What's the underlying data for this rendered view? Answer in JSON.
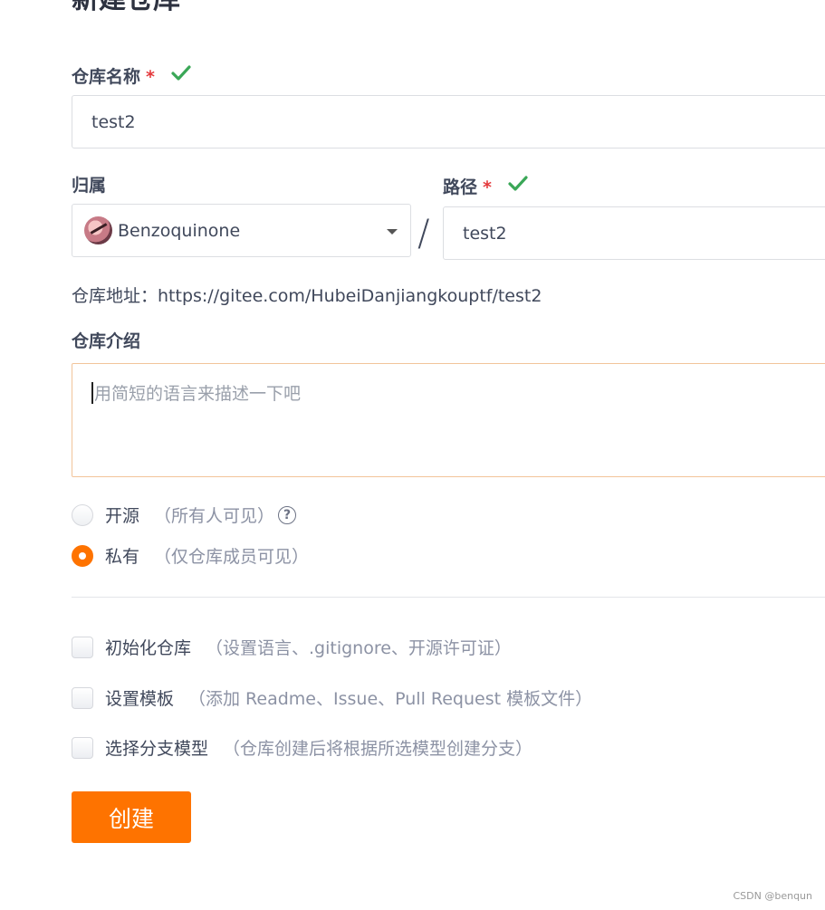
{
  "page": {
    "title": "新建仓库"
  },
  "repo_name": {
    "label": "仓库名称",
    "required_mark": "*",
    "value": "test2"
  },
  "owner": {
    "label": "归属",
    "value": "Benzoquinone"
  },
  "path": {
    "label": "路径",
    "required_mark": "*",
    "separator": "/",
    "value": "test2"
  },
  "address": {
    "text": "仓库地址：https://gitee.com/HubeiDanjiangkouptf/test2"
  },
  "description": {
    "label": "仓库介绍",
    "placeholder": "用简短的语言来描述一下吧"
  },
  "visibility": {
    "options": [
      {
        "label": "开源",
        "hint": "（所有人可见）",
        "selected": false
      },
      {
        "label": "私有",
        "hint": "（仅仓库成员可见）",
        "selected": true
      }
    ]
  },
  "options": {
    "items": [
      {
        "label": "初始化仓库",
        "hint": "（设置语言、.gitignore、开源许可证）",
        "checked": false
      },
      {
        "label": "设置模板",
        "hint": "（添加 Readme、Issue、Pull Request 模板文件）",
        "checked": false
      },
      {
        "label": "选择分支模型",
        "hint": "（仓库创建后将根据所选模型创建分支）",
        "checked": false
      }
    ]
  },
  "create_button": {
    "label": "创建"
  },
  "watermark": {
    "text": "CSDN @benqun"
  },
  "colors": {
    "accent": "#fe7300",
    "valid_check": "#3aa757",
    "required": "#e4393c"
  },
  "icons": {
    "valid": "check-icon",
    "dropdown": "caret-down-icon",
    "help": "question-circle-icon"
  }
}
